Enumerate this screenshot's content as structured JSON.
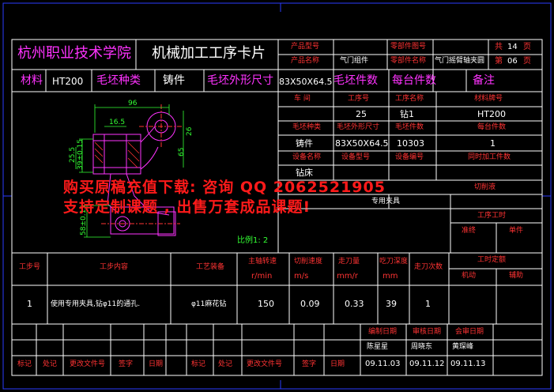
{
  "school_name": "杭州职业技术学院",
  "card_title": "机械加工工序卡片",
  "header": {
    "product_model_label": "产品型号",
    "product_name_label": "产品名称",
    "product_name": "气门组件",
    "part_drawing_no_label": "零部件图号",
    "part_name_label": "零部件名称",
    "part_name": "气门摇臂轴夹圆",
    "total_pages_label": "共",
    "total_pages": "14",
    "page_unit": "页",
    "page_label": "第",
    "page_no": "06",
    "page_unit2": "页"
  },
  "row2": {
    "material_label": "材料",
    "material": "HT200",
    "blank_type_label": "毛坯种类",
    "blank_type": "铸件",
    "blank_size_label": "毛坯外形尺寸",
    "blank_size": "83X50X64.5",
    "blank_pieces_label": "毛坯件数",
    "pieces_per_unit_label": "每台件数",
    "remarks_label": "备注"
  },
  "info": {
    "workshop_label": "车 间",
    "process_no_label": "工序号",
    "process_name_label": "工序名称",
    "material_grade_label": "材料牌号",
    "process_no": "25",
    "process_name": "钻1",
    "material_grade": "HT200",
    "blank_type_label": "毛坯种类",
    "blank_size_label": "毛坯外形尺寸",
    "blank_pieces_label": "毛坯件数",
    "pieces_per_unit_label": "每台件数",
    "blank_type": "铸件",
    "blank_size": "83X50X64.5",
    "blank_pieces": "10303",
    "pieces_per_unit": "1",
    "equipment_name_label": "设备名称",
    "equipment_model_label": "设备型号",
    "equipment_no_label": "设备编号",
    "concurrent_label": "同时加工件数",
    "equipment_name": "钻床",
    "fixture_suffix": "切削液",
    "fixture_label": "专用夹具",
    "process_hours_label": "工序工时",
    "prep_label": "准终",
    "unit_label": "单件",
    "scale": "比例1: 2"
  },
  "banner": {
    "line1": "购买原稿充值下载: 咨询 QQ 2062521905",
    "line2": "支持定制课题 , 出售万套成品课题!"
  },
  "step_header": {
    "step_no": "工步号",
    "step_content": "工步内容",
    "equipment": "工艺装备",
    "spindle_speed": "主轴转速",
    "spindle_unit": "r/min",
    "cut_speed": "切削速度",
    "cut_unit": "m/s",
    "feed": "走刀量",
    "feed_unit": "mm/r",
    "depth": "吃刀深度",
    "depth_unit": "mm",
    "passes": "走刀次数",
    "quota": "工时定额",
    "machine": "机动",
    "aux": "辅助"
  },
  "steps": [
    {
      "no": "1",
      "content": "使用专用夹具,钻φ11的通孔.",
      "equipment": "φ11麻花钻",
      "speed": "150",
      "cut": "0.09",
      "feed": "0.33",
      "depth": "39",
      "passes": "1"
    }
  ],
  "sign": {
    "compile_label": "编制日期",
    "review_label": "审核日期",
    "approve_label": "会审日期",
    "compiler": "陈星星",
    "reviewer": "周晓东",
    "approver": "黄琛峰",
    "compile_date": "09.11.03",
    "review_date": "09.11.12",
    "approve_date": "09.11.13",
    "mark": "标记",
    "place": "处记",
    "change_doc": "更改文件号",
    "signature": "签字",
    "date": "日期"
  },
  "drawing_dims": [
    "96",
    "16.5",
    "26",
    "39±0.15",
    "25.5",
    "65",
    "58±0.15"
  ]
}
